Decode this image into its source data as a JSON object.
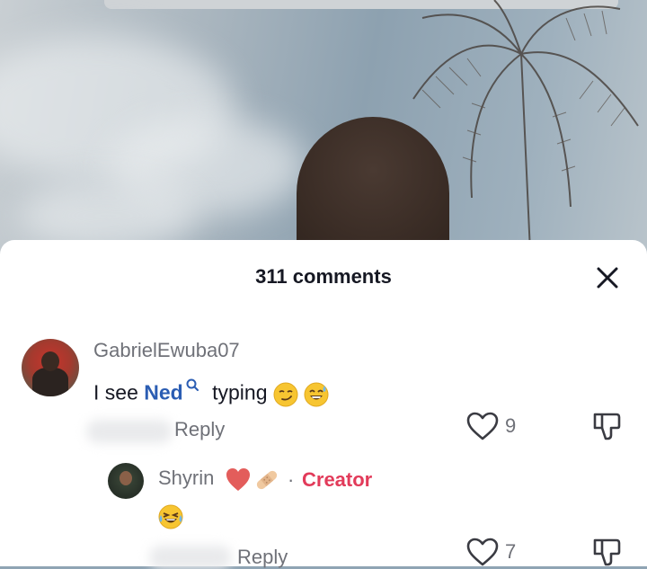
{
  "header": {
    "comment_count": "311 comments"
  },
  "comments": [
    {
      "username": "GabrielEwuba07",
      "text_before": "I see ",
      "mention": "Ned",
      "text_after": " typing",
      "emojis": [
        "smirk-emoji",
        "sweat-smile-emoji"
      ],
      "reply_label": "Reply",
      "like_count": "9"
    }
  ],
  "replies": [
    {
      "username": "Shyrin",
      "name_emojis": [
        "red-heart-emoji",
        "bandage-emoji"
      ],
      "separator": "·",
      "badge": "Creator",
      "text_emojis": [
        "laughing-tears-emoji"
      ],
      "reply_label": "Reply",
      "like_count": "7"
    }
  ],
  "colors": {
    "creator_badge": "#e23b5a",
    "mention": "#2b5db3",
    "secondary_text": "#6f7178",
    "primary_text": "#161823"
  }
}
